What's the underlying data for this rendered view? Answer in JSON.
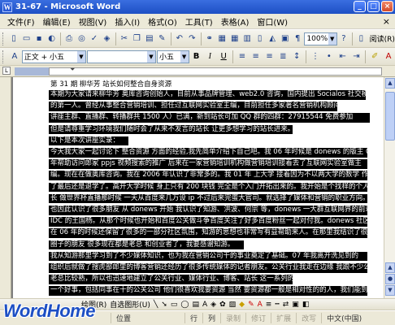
{
  "window": {
    "title": "31-67 - Microsoft Word"
  },
  "menu": [
    "文件(F)",
    "编辑(E)",
    "视图(V)",
    "插入(I)",
    "格式(O)",
    "工具(T)",
    "表格(A)",
    "窗口(W)"
  ],
  "toolbar": {
    "zoom": "100%",
    "read_label": "阅读(R)"
  },
  "format_toolbar": {
    "style": "正文 + 小五",
    "font_size": "小五"
  },
  "document": {
    "heading": "第 31 期 柳华芳 站长如何整合自身资源",
    "lines": [
      "本期为大家请来柳华芳 奥库咨询创始人，目前从事品牌管理、web2.0 咨询，国内提出 Socialos 社交模型",
      "的第一人。曾经从事整合营销培训、担任过互联网实验室主编，目前担任多家著名营销机构顾问。",
      "讲座主群、直播群、转播群共 1500 人）已满，新到站长可加 QQ 群的四群：27915544 免费参加",
      "但是请尊重学习环境我们随时会了从来不发言的站长 让更多想学习的站长进来。",
      "以下是本次讲座实录：",
      "今天我大家一起讨论下 整合资源 方面的经验,我先简单介绍下自己吧。我 06 年时候是 donews 的版主  07",
      "年帮助访问郎家 ppjs 视频搜索的推广 后来在一家营销培训机构做营销培训接着去了互联网实验室做主",
      "编。现在在做奥库咨询。我在 2006 年认识了非常多的。我 01 年 上大学 接着因为不以两大学的数学 作学",
      "了最后还是退学了。高开大学时候 身上只有 200 块钱 完全是个入门开拓出来的。我开始是个找样的个人站长",
      "长 做世界杯直播那时候 一天从百度来几万设 ip 不过后来完蛋大官司。就选择了媒体和营销的职业方向。",
      "也因此认识了很多朋友 从 donews 开始 我认识了知游、洪波、何宗 等，donews 一大群互联网界的前辈。还有",
      "IDC 的王国杨。从那个时候也开始和百度公关做斗争百度关注了好多百度粉丝一起对付我。donews 社区",
      "在 06 年的时候还保留了很多的一部分社区氛围，知游的思想也非常写有益帮助来人。在那里我结识了很多 IT",
      "圈子的朋友 很多现在都是老总 和创业者了，我要感谢知游。",
      "我从知游那里学习到了不少媒体知识，也为我在营销公司干的事业奠定了基础。07 年我离开洗见到的",
      "组织后就做了搜虎部郎里的博客营销还经历了很多传统媒体的记者朋友。公关行业我走在边缘 我跟不少公司",
      "老总比较熟，所以也迅速地建立了公关行业、媒体行业、博客、站长 这一系列的关系。",
      "一个好事，包括同事在十的公关公司 他们很喜欢我要资源 当然 要资源都一般是相对性的的人，我们能到"
    ]
  },
  "drawing_toolbar": {
    "draw": "绘图(R)",
    "autoshapes": "自选图形(U)"
  },
  "status": {
    "position": "位置",
    "line": "行",
    "col": "列",
    "rec": "录制",
    "trk": "修订",
    "ext": "扩展",
    "ovr": "改写",
    "lang": "中文(中国)"
  },
  "logo": "WordHome"
}
